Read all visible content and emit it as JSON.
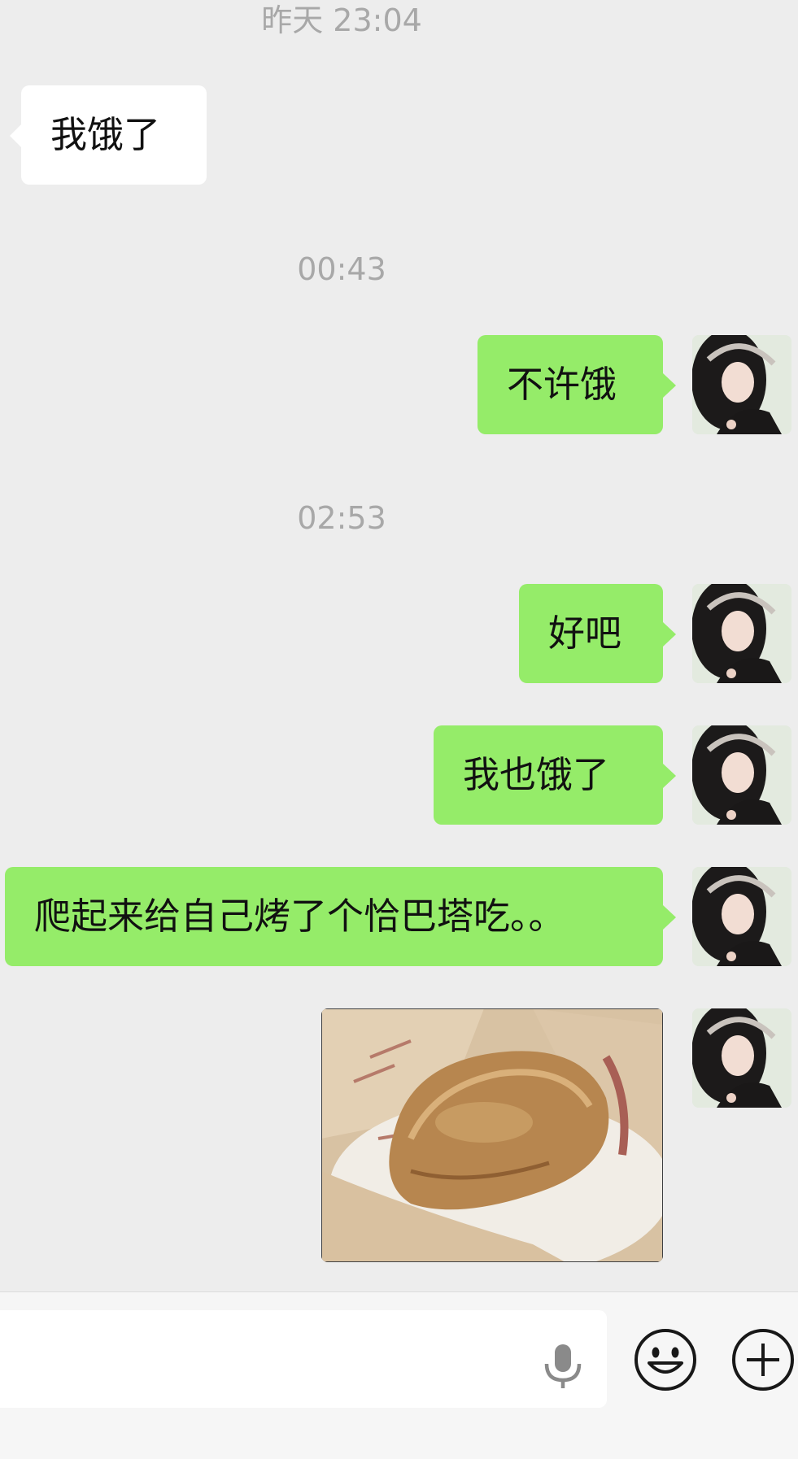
{
  "chat": {
    "messages": [
      {
        "type": "timestamp",
        "text": "昨天 23:04"
      },
      {
        "type": "incoming",
        "text": "我饿了"
      },
      {
        "type": "timestamp",
        "text": "00:43"
      },
      {
        "type": "outgoing",
        "text": "不许饿"
      },
      {
        "type": "timestamp",
        "text": "02:53"
      },
      {
        "type": "outgoing",
        "text": "好吧"
      },
      {
        "type": "outgoing",
        "text": "我也饿了"
      },
      {
        "type": "outgoing",
        "text": "爬起来给自己烤了个恰巴塔吃。。"
      },
      {
        "type": "outgoing-image",
        "image": "photo of a baked ciabatta on a patterned paper wrapper"
      }
    ]
  },
  "input_bar": {
    "text_value": "",
    "icons": {
      "mic": "microphone-icon",
      "emoji": "smiley-face-icon",
      "more": "plus-circle-icon"
    }
  },
  "colors": {
    "background": "#ededed",
    "outgoing_bubble": "#95ec69",
    "incoming_bubble": "#ffffff",
    "timestamp_text": "#a8a8a8",
    "input_bar_background": "#f6f6f6"
  }
}
